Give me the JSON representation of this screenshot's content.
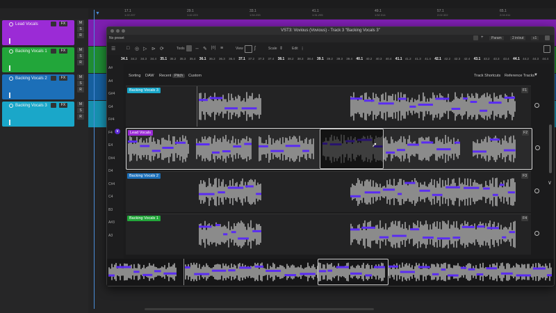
{
  "timeline": {
    "ticks": [
      {
        "bar": "17.1",
        "time": "1:22.237"
      },
      {
        "bar": "29.1",
        "time": "1:42.223"
      },
      {
        "bar": "33.1",
        "time": "1:54.233"
      },
      {
        "bar": "41.1",
        "time": "1:31.295"
      },
      {
        "bar": "49.1",
        "time": "1:52.314"
      },
      {
        "bar": "57.1",
        "time": "2:02.322"
      },
      {
        "bar": "65.1",
        "time": "2:04.011"
      }
    ]
  },
  "tracks": [
    {
      "name": "Lead Vocals",
      "color": "#9b2bd6"
    },
    {
      "name": "Backing Vocals 1",
      "color": "#22a63a"
    },
    {
      "name": "Backing Vocals 2",
      "color": "#1c6fb8"
    },
    {
      "name": "Backing Vocals 3",
      "color": "#1aa7c9"
    }
  ],
  "track_buttons": {
    "fx": "FX",
    "mute": "M",
    "solo": "S",
    "record": "R"
  },
  "plugin": {
    "title": "VST3: Vovious (Vovious) - Track 3 \"Backing Vocals 3\"",
    "preset": "No preset",
    "param_label": "Param",
    "in_out_label": "2 in/out",
    "io_label": "c1",
    "toolbar": {
      "tools_label": "Tools",
      "view_label": "View",
      "snap_label": "Scale",
      "edit_label": "Edit"
    },
    "ruler": [
      "34.1",
      "34.2",
      "34.3",
      "34.4",
      "35.1",
      "35.2",
      "35.3",
      "35.4",
      "36.1",
      "36.2",
      "36.3",
      "36.4",
      "37.1",
      "37.2",
      "37.3",
      "37.4",
      "38.1",
      "38.2",
      "38.3",
      "38.4",
      "39.1",
      "39.2",
      "39.3",
      "39.4",
      "40.1",
      "40.2",
      "40.3",
      "40.4",
      "41.1",
      "41.2",
      "41.3",
      "41.4",
      "42.1",
      "42.2",
      "42.3",
      "42.4",
      "43.1",
      "43.2",
      "43.3",
      "43.4",
      "44.1",
      "44.2",
      "44.3",
      "44.4"
    ],
    "tabs": [
      "Sorting",
      "DAW",
      "Recent",
      "Pitch",
      "Custom"
    ],
    "active_tab": "Pitch",
    "right_tabs": [
      "Track Shortcuts",
      "Reference Tracks"
    ],
    "keys": [
      "A#",
      "A4",
      "G#4",
      "G4",
      "F#4",
      "F4",
      "E4",
      "D#4",
      "D4",
      "C#4",
      "C4",
      "B3",
      "A#3",
      "A3"
    ],
    "lanes": [
      {
        "name": "Backing Vocals 3",
        "flag": "F1",
        "color": "#1aa7c9"
      },
      {
        "name": "Lead Vocals",
        "flag": "F2",
        "color": "#9b2bd6"
      },
      {
        "name": "Backing Vocals 2",
        "flag": "F3",
        "color": "#1c6fb8"
      },
      {
        "name": "Backing Vocals 1",
        "flag": "F4",
        "color": "#22a63a"
      }
    ]
  }
}
